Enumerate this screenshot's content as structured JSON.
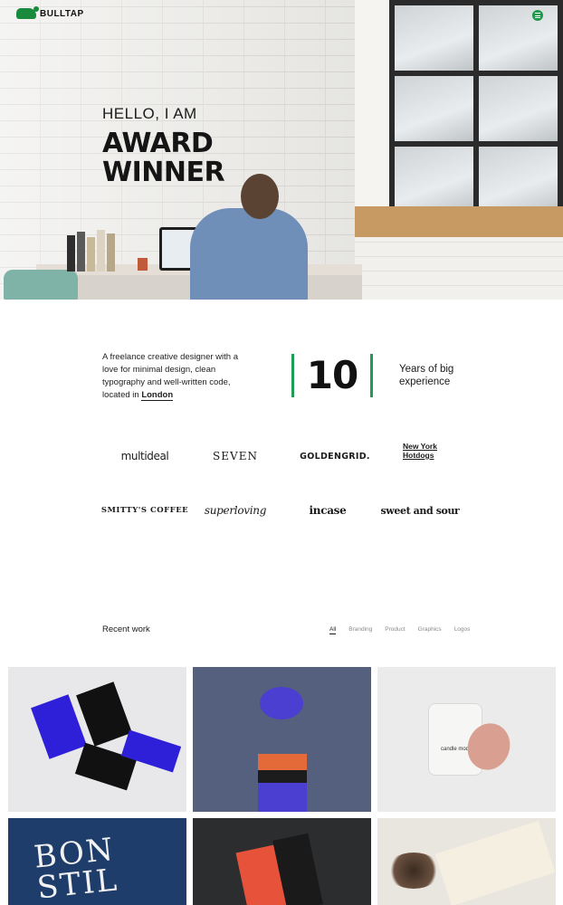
{
  "header": {
    "logo_text": "BULLTAP",
    "logo_icon": "bull-icon",
    "menu_icon": "hamburger-menu-icon",
    "accent_color": "#1f9d55"
  },
  "hero": {
    "hello": "HELLO, I AM",
    "title_line1": "AWARD",
    "title_line2": "WINNER"
  },
  "intro": {
    "text_before": "A freelance creative designer with a love for minimal design, clean typography and well-written code, located in ",
    "city": "London",
    "count": "10",
    "count_label": "Years of big experience"
  },
  "clients": [
    {
      "name": "multideal"
    },
    {
      "name": "SEVEN"
    },
    {
      "name": "GOLDENGRID."
    },
    {
      "name": "New York Hotdogs"
    },
    {
      "name": "SMITTY'S COFFEE"
    },
    {
      "name": "superloving"
    },
    {
      "name": "incase"
    },
    {
      "name": "sweet and sour"
    }
  ],
  "recent_work": {
    "title": "Recent work",
    "filters": [
      "All",
      "Branding",
      "Product",
      "Graphics",
      "Logos"
    ],
    "active_filter": "All",
    "tiles": [
      {
        "alt": "business-cards"
      },
      {
        "alt": "coffee-cups"
      },
      {
        "alt": "candle-jar",
        "product_text": "candle module"
      },
      {
        "alt": "bonstil-poster",
        "text": "BON STIL"
      },
      {
        "alt": "packaging-box"
      },
      {
        "alt": "tea-cards"
      }
    ]
  }
}
